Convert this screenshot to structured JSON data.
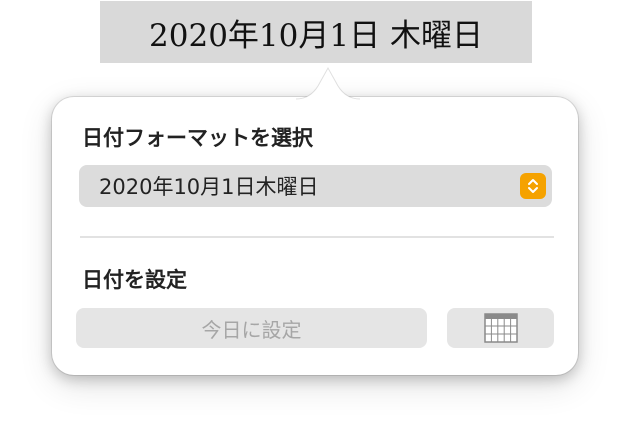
{
  "date_field": {
    "value": "2020年10月1日 木曜日"
  },
  "popover": {
    "format_section": {
      "title": "日付フォーマットを選択",
      "selected_format": "2020年10月1日木曜日",
      "stepper_icon": "chevron-up-down-icon"
    },
    "set_section": {
      "title": "日付を設定",
      "today_button_label": "今日に設定",
      "calendar_icon": "calendar-icon"
    }
  },
  "colors": {
    "accent": "#f5a200",
    "field_background": "#d9d9d9",
    "control_background": "#e5e5e5"
  }
}
